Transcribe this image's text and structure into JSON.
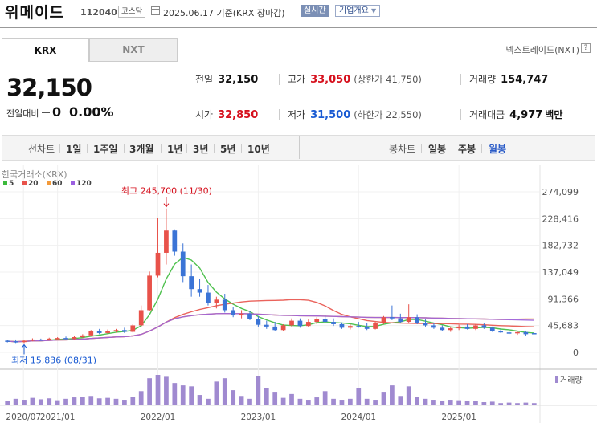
{
  "header": {
    "name": "위메이드",
    "code": "112040",
    "market": "코스닥",
    "date": "2025.06.17",
    "basis": "기준(KRX 장마감)",
    "realtime_label": "실시간",
    "corp_info_label": "기업개요"
  },
  "tabs": [
    {
      "label": "KRX",
      "selected": true
    },
    {
      "label": "NXT",
      "selected": false
    }
  ],
  "nxt_link": "넥스트레이드(NXT)",
  "help_label": "?",
  "quote": {
    "price": "32,150",
    "change_label": "전일대비",
    "change_value": "0",
    "change_percent": "0.00%"
  },
  "stats": {
    "prev_close": {
      "label": "전일",
      "value": "32,150"
    },
    "high": {
      "label": "고가",
      "value": "33,050",
      "sub": "(상한가 41,750)"
    },
    "volume": {
      "label": "거래량",
      "value": "154,747"
    },
    "open": {
      "label": "시가",
      "value": "32,850"
    },
    "low": {
      "label": "저가",
      "value": "31,500",
      "sub": "(하한가 22,550)"
    },
    "amount": {
      "label": "거래대금",
      "value": "4,977",
      "unit": "백만"
    }
  },
  "toolbar": {
    "line_chart_label": "선차트",
    "line_periods": [
      "1일",
      "1주일",
      "3개월",
      "1년",
      "3년",
      "5년",
      "10년"
    ],
    "candle_chart_label": "봉차트",
    "candle_periods": [
      "일봉",
      "주봉",
      "월봉"
    ],
    "selected_period": "월봉"
  },
  "chart_data": {
    "type": "candlestick",
    "source_label": "한국거래소(KRX)",
    "ma_legend": [
      {
        "name": "5",
        "color": "#3cba3c"
      },
      {
        "name": "20",
        "color": "#e8524a"
      },
      {
        "name": "60",
        "color": "#f39a3a"
      },
      {
        "name": "120",
        "color": "#9b5fe0"
      }
    ],
    "y_ticks": [
      "274,099",
      "228,416",
      "182,732",
      "137,049",
      "91,366",
      "45,683",
      "0"
    ],
    "ylim": [
      0,
      274099
    ],
    "x_ticks": [
      "2020/07",
      "2021/01",
      "2022/01",
      "2023/01",
      "2024/01",
      "2025/01"
    ],
    "high_annotation": "최고 245,700 (11/30)",
    "low_annotation": "최저 15,836 (08/31)",
    "volume_label": "거래량",
    "up_color": "#e8524a",
    "down_color": "#3b74d6",
    "candles": [
      [
        20000,
        21000,
        17000,
        19000
      ],
      [
        19000,
        22000,
        16000,
        17500
      ],
      [
        17500,
        21000,
        15836,
        20000
      ],
      [
        20000,
        24000,
        19000,
        22000
      ],
      [
        22000,
        23500,
        20000,
        21000
      ],
      [
        21000,
        25000,
        20500,
        23500
      ],
      [
        23500,
        26000,
        22000,
        24500
      ],
      [
        24500,
        27000,
        22500,
        23000
      ],
      [
        23000,
        28000,
        22000,
        26000
      ],
      [
        26000,
        31000,
        25000,
        29000
      ],
      [
        29000,
        38000,
        28000,
        36000
      ],
      [
        36000,
        40000,
        31000,
        33000
      ],
      [
        33000,
        39000,
        31500,
        36000
      ],
      [
        36000,
        40000,
        34000,
        38000
      ],
      [
        38000,
        42000,
        33000,
        35000
      ],
      [
        35000,
        48000,
        34000,
        46000
      ],
      [
        46000,
        80000,
        44000,
        72000
      ],
      [
        72000,
        138000,
        70000,
        131000
      ],
      [
        131000,
        230000,
        128000,
        170000
      ],
      [
        170000,
        245700,
        150000,
        208000
      ],
      [
        208000,
        210000,
        165000,
        172000
      ],
      [
        172000,
        186000,
        120000,
        130000
      ],
      [
        130000,
        150000,
        95000,
        108000
      ],
      [
        108000,
        125000,
        95000,
        102000
      ],
      [
        102000,
        115000,
        80000,
        84000
      ],
      [
        84000,
        95000,
        75000,
        90000
      ],
      [
        90000,
        100000,
        68000,
        72000
      ],
      [
        72000,
        78000,
        60000,
        63000
      ],
      [
        63000,
        72000,
        58000,
        66000
      ],
      [
        66000,
        70000,
        55000,
        57000
      ],
      [
        57000,
        62000,
        44000,
        47000
      ],
      [
        47000,
        54000,
        40000,
        44000
      ],
      [
        44000,
        52000,
        36000,
        38000
      ],
      [
        38000,
        48000,
        36000,
        46000
      ],
      [
        46000,
        58000,
        44000,
        54000
      ],
      [
        54000,
        58000,
        42000,
        45000
      ],
      [
        45000,
        56000,
        43000,
        52000
      ],
      [
        52000,
        60000,
        48000,
        57000
      ],
      [
        57000,
        64000,
        50000,
        52000
      ],
      [
        52000,
        58000,
        45000,
        48000
      ],
      [
        48000,
        51000,
        40000,
        42000
      ],
      [
        42000,
        48000,
        39000,
        45000
      ],
      [
        45000,
        52000,
        42000,
        44000
      ],
      [
        44000,
        50000,
        38000,
        40000
      ],
      [
        40000,
        52000,
        39000,
        50000
      ],
      [
        50000,
        62000,
        48000,
        60000
      ],
      [
        60000,
        80000,
        55000,
        58000
      ],
      [
        58000,
        66000,
        50000,
        52000
      ],
      [
        52000,
        82000,
        50000,
        60000
      ],
      [
        60000,
        65000,
        48000,
        50000
      ],
      [
        50000,
        56000,
        44000,
        46000
      ],
      [
        46000,
        50000,
        40000,
        42000
      ],
      [
        42000,
        46000,
        36000,
        38000
      ],
      [
        38000,
        44000,
        35000,
        41000
      ],
      [
        41000,
        47000,
        38000,
        44000
      ],
      [
        44000,
        48000,
        39000,
        40000
      ],
      [
        40000,
        48000,
        38000,
        46000
      ],
      [
        46000,
        50000,
        40000,
        42000
      ],
      [
        42000,
        44000,
        35000,
        37000
      ],
      [
        37000,
        40000,
        33000,
        34000
      ],
      [
        34000,
        37000,
        31000,
        33500
      ],
      [
        33500,
        35000,
        30000,
        34500
      ],
      [
        34500,
        36000,
        28500,
        31000
      ],
      [
        32850,
        33050,
        31500,
        32150
      ]
    ],
    "volumes": [
      8,
      12,
      10,
      14,
      11,
      13,
      9,
      12,
      15,
      16,
      18,
      13,
      14,
      12,
      10,
      16,
      28,
      55,
      62,
      58,
      45,
      40,
      38,
      20,
      12,
      48,
      55,
      30,
      18,
      12,
      60,
      35,
      25,
      14,
      22,
      12,
      10,
      15,
      28,
      12,
      10,
      12,
      35,
      12,
      10,
      25,
      40,
      18,
      38,
      16,
      12,
      10,
      8,
      10,
      9,
      7,
      8,
      5,
      6,
      3,
      4,
      3,
      4,
      3
    ]
  }
}
